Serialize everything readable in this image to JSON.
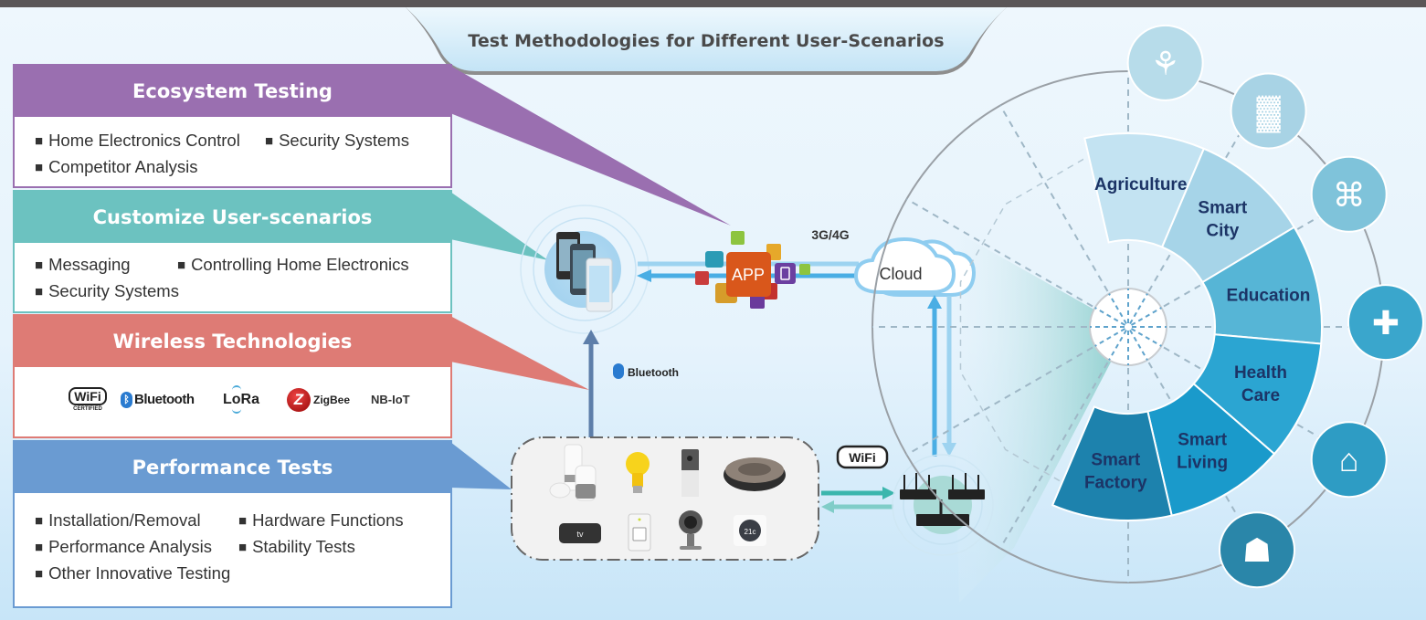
{
  "title": "Test Methodologies for Different User-Scenarios",
  "panels": {
    "ecosystem": {
      "title": "Ecosystem Testing",
      "color": "#9a6fb0",
      "items": [
        "Home Electronics Control",
        "Security Systems",
        "Competitor Analysis"
      ]
    },
    "customize": {
      "title": "Customize User-scenarios",
      "color": "#6cc2c0",
      "items": [
        "Messaging",
        "Controlling Home Electronics",
        "Security Systems"
      ]
    },
    "wireless": {
      "title": "Wireless Technologies",
      "color": "#de7b75",
      "logos": {
        "wifi": "WiFi",
        "wifi_sub": "CERTIFIED",
        "bluetooth": "Bluetooth",
        "lora": "LoRa",
        "zigbee": "ZigBee",
        "nbiot": "NB-IoT"
      }
    },
    "performance": {
      "title": "Performance Tests",
      "color": "#6a9bd2",
      "items": [
        "Installation/Removal",
        "Hardware Functions",
        "Performance Analysis",
        "Stability Tests",
        "Other Innovative Testing"
      ]
    }
  },
  "diagram": {
    "app_label": "APP",
    "network_label": "3G/4G",
    "cloud_label": "Cloud",
    "bluetooth_label": "Bluetooth",
    "wifi_label": "WiFi",
    "thermostat_label": "21c",
    "tv_label": "tv"
  },
  "sectors": [
    {
      "label_lines": [
        "Agriculture"
      ],
      "color": "#c3e3f2",
      "icon": "plant-hand-icon"
    },
    {
      "label_lines": [
        "Smart",
        "City"
      ],
      "color": "#a6d4e8",
      "icon": "city-icon"
    },
    {
      "label_lines": [
        "Education"
      ],
      "color": "#56b5d6",
      "icon": "education-icon"
    },
    {
      "label_lines": [
        "Health",
        "Care"
      ],
      "color": "#2ba5d2",
      "icon": "medical-kit-icon"
    },
    {
      "label_lines": [
        "Smart",
        "Living"
      ],
      "color": "#1a9acb",
      "icon": "smart-home-icon"
    },
    {
      "label_lines": [
        "Smart",
        "Factory"
      ],
      "color": "#1d82ad",
      "icon": "factory-icon"
    }
  ]
}
